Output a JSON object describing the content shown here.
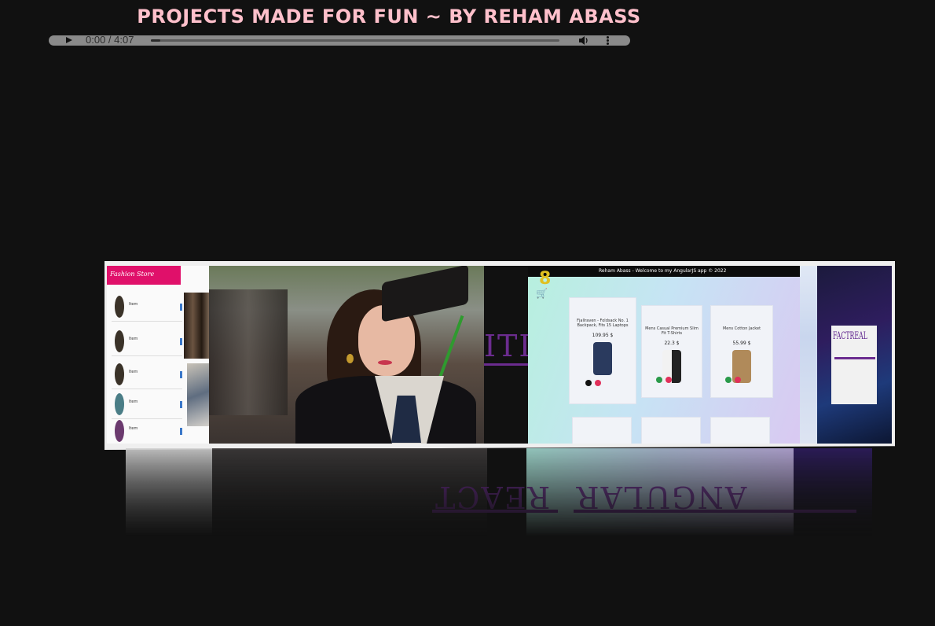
{
  "page": {
    "title": "PROJECTS MADE FOR FUN ~ BY REHAM ABASS"
  },
  "audio_player": {
    "time_display": "0:00 / 4:07",
    "play_icon": "play-icon",
    "volume_icon": "volume-icon",
    "more_icon": "more-options-icon",
    "progress_fraction": 0
  },
  "carousel": {
    "label_left": "ITI",
    "reflection_labels": [
      "REACT",
      "ANGULAR"
    ],
    "panel_store": {
      "header": "Fashion Store"
    },
    "panel_angular": {
      "header": "Reham Abass - Welcome to my AngularJS app © 2022",
      "products": [
        {
          "name": "Fjallraven - Foldsack No. 1 Backpack, Fits 15 Laptops",
          "price": "109.95 $"
        },
        {
          "name": "Mens Casual Premium Slim Fit T-Shirts",
          "price": "22.3 $"
        },
        {
          "name": "Mens Cotton Jacket",
          "price": "55.99 $"
        }
      ]
    },
    "panel_react": {
      "heading": "FACTREAL"
    }
  },
  "colors": {
    "background": "#111111",
    "title": "#ffc0cb",
    "accent_purple": "#6b2c8f"
  }
}
